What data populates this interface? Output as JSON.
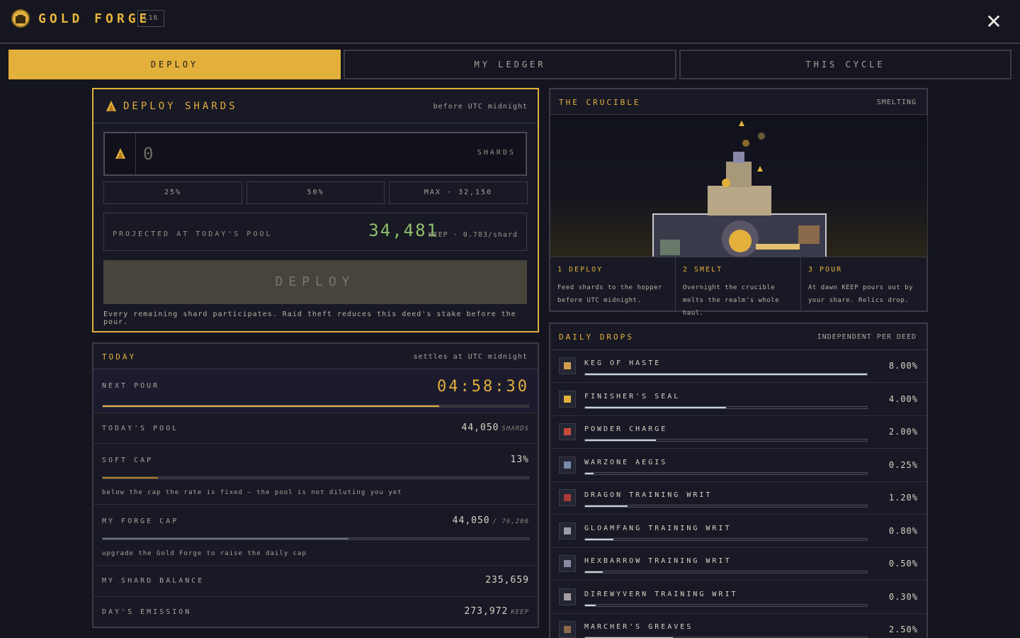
{
  "app": {
    "title": "GOLD FORGE",
    "level": "L16",
    "close": "✕"
  },
  "tabs": [
    {
      "label": "DEPLOY"
    },
    {
      "label": "MY LEDGER"
    },
    {
      "label": "THIS CYCLE"
    }
  ],
  "deploy": {
    "title": "DEPLOY SHARDS",
    "deadline": "before UTC midnight",
    "placeholder": "0",
    "unit": "SHARDS",
    "pct_25": "25%",
    "pct_50": "50%",
    "max": "MAX · 32,150",
    "projected_label": "PROJECTED AT TODAY'S POOL",
    "projected_value": "34,481",
    "projected_rate": "KEEP · 0.783/shard",
    "button": "DEPLOY",
    "note": "Every remaining shard participates. Raid theft reduces this deed's stake before the pour."
  },
  "today": {
    "title": "TODAY",
    "settles": "settles at UTC midnight",
    "next_pour_label": "NEXT POUR",
    "next_pour": "04:58:30",
    "next_pour_progress": 0.79,
    "pool_label": "TODAY'S POOL",
    "pool": "44,050",
    "pool_unit": "SHARDS",
    "softcap_label": "SOFT CAP",
    "softcap": "13%",
    "softcap_progress": 0.13,
    "softcap_note": "below the cap the rate is fixed — the pool is not diluting you yet",
    "forgecap_label": "MY FORGE CAP",
    "forgecap": "44,050",
    "forgecap_max": "/ 76,200",
    "forgecap_progress": 0.578,
    "forgecap_note": "upgrade the Gold Forge to raise the daily cap",
    "balance_label": "MY SHARD BALANCE",
    "balance": "235,659",
    "emission_label": "DAY'S EMISSION",
    "emission": "273,972",
    "emission_unit": "KEEP"
  },
  "crucible": {
    "title": "THE CRUCIBLE",
    "status": "SMELTING",
    "steps": [
      {
        "title": "1 DEPLOY",
        "desc": "Feed shards to the hopper before UTC midnight."
      },
      {
        "title": "2 SMELT",
        "desc": "Overnight the crucible melts the realm's whole haul."
      },
      {
        "title": "3 POUR",
        "desc": "At dawn KEEP pours out by your share. Relics drop."
      }
    ]
  },
  "drops": {
    "title": "DAILY DROPS",
    "note": "INDEPENDENT PER DEED",
    "items": [
      {
        "name": "KEG OF HASTE",
        "pct": "8.00%",
        "progress": 0.08,
        "icon": "keg-icon"
      },
      {
        "name": "FINISHER'S SEAL",
        "pct": "4.00%",
        "progress": 0.04,
        "icon": "hourglass-icon"
      },
      {
        "name": "POWDER CHARGE",
        "pct": "2.00%",
        "progress": 0.02,
        "icon": "dynamite-icon"
      },
      {
        "name": "WARZONE AEGIS",
        "pct": "0.25%",
        "progress": 0.0025,
        "icon": "shield-icon"
      },
      {
        "name": "DRAGON TRAINING WRIT",
        "pct": "1.20%",
        "progress": 0.012,
        "icon": "dragon-icon"
      },
      {
        "name": "GLOAMFANG TRAINING WRIT",
        "pct": "0.80%",
        "progress": 0.008,
        "icon": "beast-icon"
      },
      {
        "name": "HEXBARROW TRAINING WRIT",
        "pct": "0.50%",
        "progress": 0.005,
        "icon": "hexbarrow-icon"
      },
      {
        "name": "DIREWYVERN TRAINING WRIT",
        "pct": "0.30%",
        "progress": 0.003,
        "icon": "wyvern-icon"
      },
      {
        "name": "MARCHER'S GREAVES",
        "pct": "2.50%",
        "progress": 0.025,
        "icon": "greaves-icon"
      }
    ]
  },
  "colors": {
    "accent": "#e3b03c",
    "positive": "#8fbf6a",
    "bar": "#c8d4d8"
  }
}
